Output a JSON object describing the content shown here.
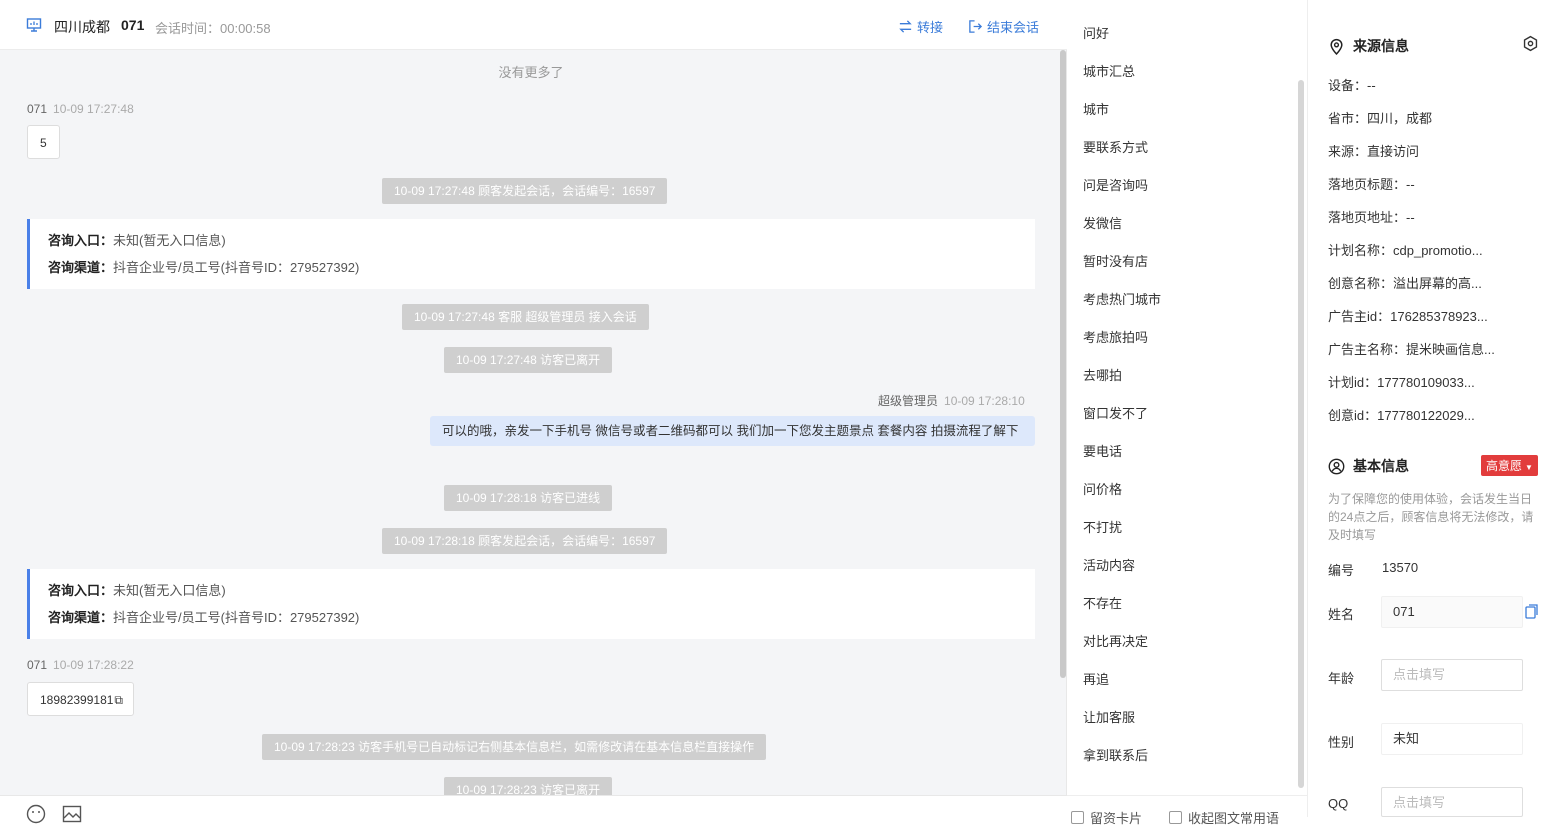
{
  "header": {
    "city": "四川成都",
    "visitor_id": "071",
    "session_time": "会话时间：00:00:58",
    "transfer_label": "转接",
    "end_label": "结束会话"
  },
  "chat": {
    "no_more": "没有更多了",
    "msg1_sender": "071",
    "msg1_time": "10-09 17:27:48",
    "msg1_text": "5",
    "sys1": "10-09 17:27:48 顾客发起会话，会话编号：16597",
    "card1_entry_label": "咨询入口：",
    "card1_entry_value": "未知(暂无入口信息)",
    "card1_channel_label": "咨询渠道：",
    "card1_channel_value": "抖音企业号/员工号(抖音号ID：279527392)",
    "sys2": "10-09 17:27:48 客服 超级管理员 接入会话",
    "sys3": "10-09 17:27:48 访客已离开",
    "agent_name": "超级管理员",
    "agent_time": "10-09 17:28:10",
    "agent_text": "可以的哦，亲发一下手机号 微信号或者二维码都可以 我们加一下您发主题景点 套餐内容 拍摄流程了解下",
    "sys4": "10-09 17:28:18 访客已进线",
    "sys5": "10-09 17:28:18 顾客发起会话，会话编号：16597",
    "card2_entry_label": "咨询入口：",
    "card2_entry_value": "未知(暂无入口信息)",
    "card2_channel_label": "咨询渠道：",
    "card2_channel_value": "抖音企业号/员工号(抖音号ID：279527392)",
    "msg2_sender": "071",
    "msg2_time": "10-09 17:28:22",
    "msg2_text": "18982399181",
    "sys6": "10-09 17:28:23 访客手机号已自动标记右侧基本信息栏，如需修改请在基本信息栏直接操作",
    "sys7": "10-09 17:28:23 访客已离开"
  },
  "phrases": [
    "问好",
    "城市汇总",
    "城市",
    "要联系方式",
    "问是咨询吗",
    "发微信",
    "暂时没有店",
    "考虑热门城市",
    "考虑旅拍吗",
    "去哪拍",
    "窗口发不了",
    "要电话",
    "问价格",
    "不打扰",
    "活动内容",
    "不存在",
    "对比再决定",
    "再追",
    "让加客服",
    "拿到联系后"
  ],
  "phrase_footer": {
    "card": "留资卡片",
    "collapse": "收起图文常用语"
  },
  "source_info": {
    "title": "来源信息",
    "rows": [
      "设备：--",
      "省市：四川，成都",
      "来源：直接访问",
      "落地页标题：--",
      "落地页地址：--",
      "计划名称：cdp_promotio...",
      "创意名称：溢出屏幕的高...",
      "广告主id：176285378923...",
      "广告主名称：提米映画信息...",
      "计划id：177780109033...",
      "创意id：177780122029..."
    ]
  },
  "basic_info": {
    "title": "基本信息",
    "intent": "高意愿",
    "note": "为了保障您的使用体验，会话发生当日的24点之后，顾客信息将无法修改，请及时填写",
    "id_label": "编号",
    "id_value": "13570",
    "name_label": "姓名",
    "name_value": "071",
    "age_label": "年龄",
    "age_placeholder": "点击填写",
    "gender_label": "性别",
    "gender_value": "未知",
    "qq_label": "QQ",
    "qq_placeholder": "点击填写"
  },
  "colors": {
    "accent": "#3b7cd9",
    "card_border": "#4a80e8",
    "agent_bubble": "#dde8fb",
    "system_pill": "#cfcfcf",
    "intent_badge": "#e23c3c"
  }
}
